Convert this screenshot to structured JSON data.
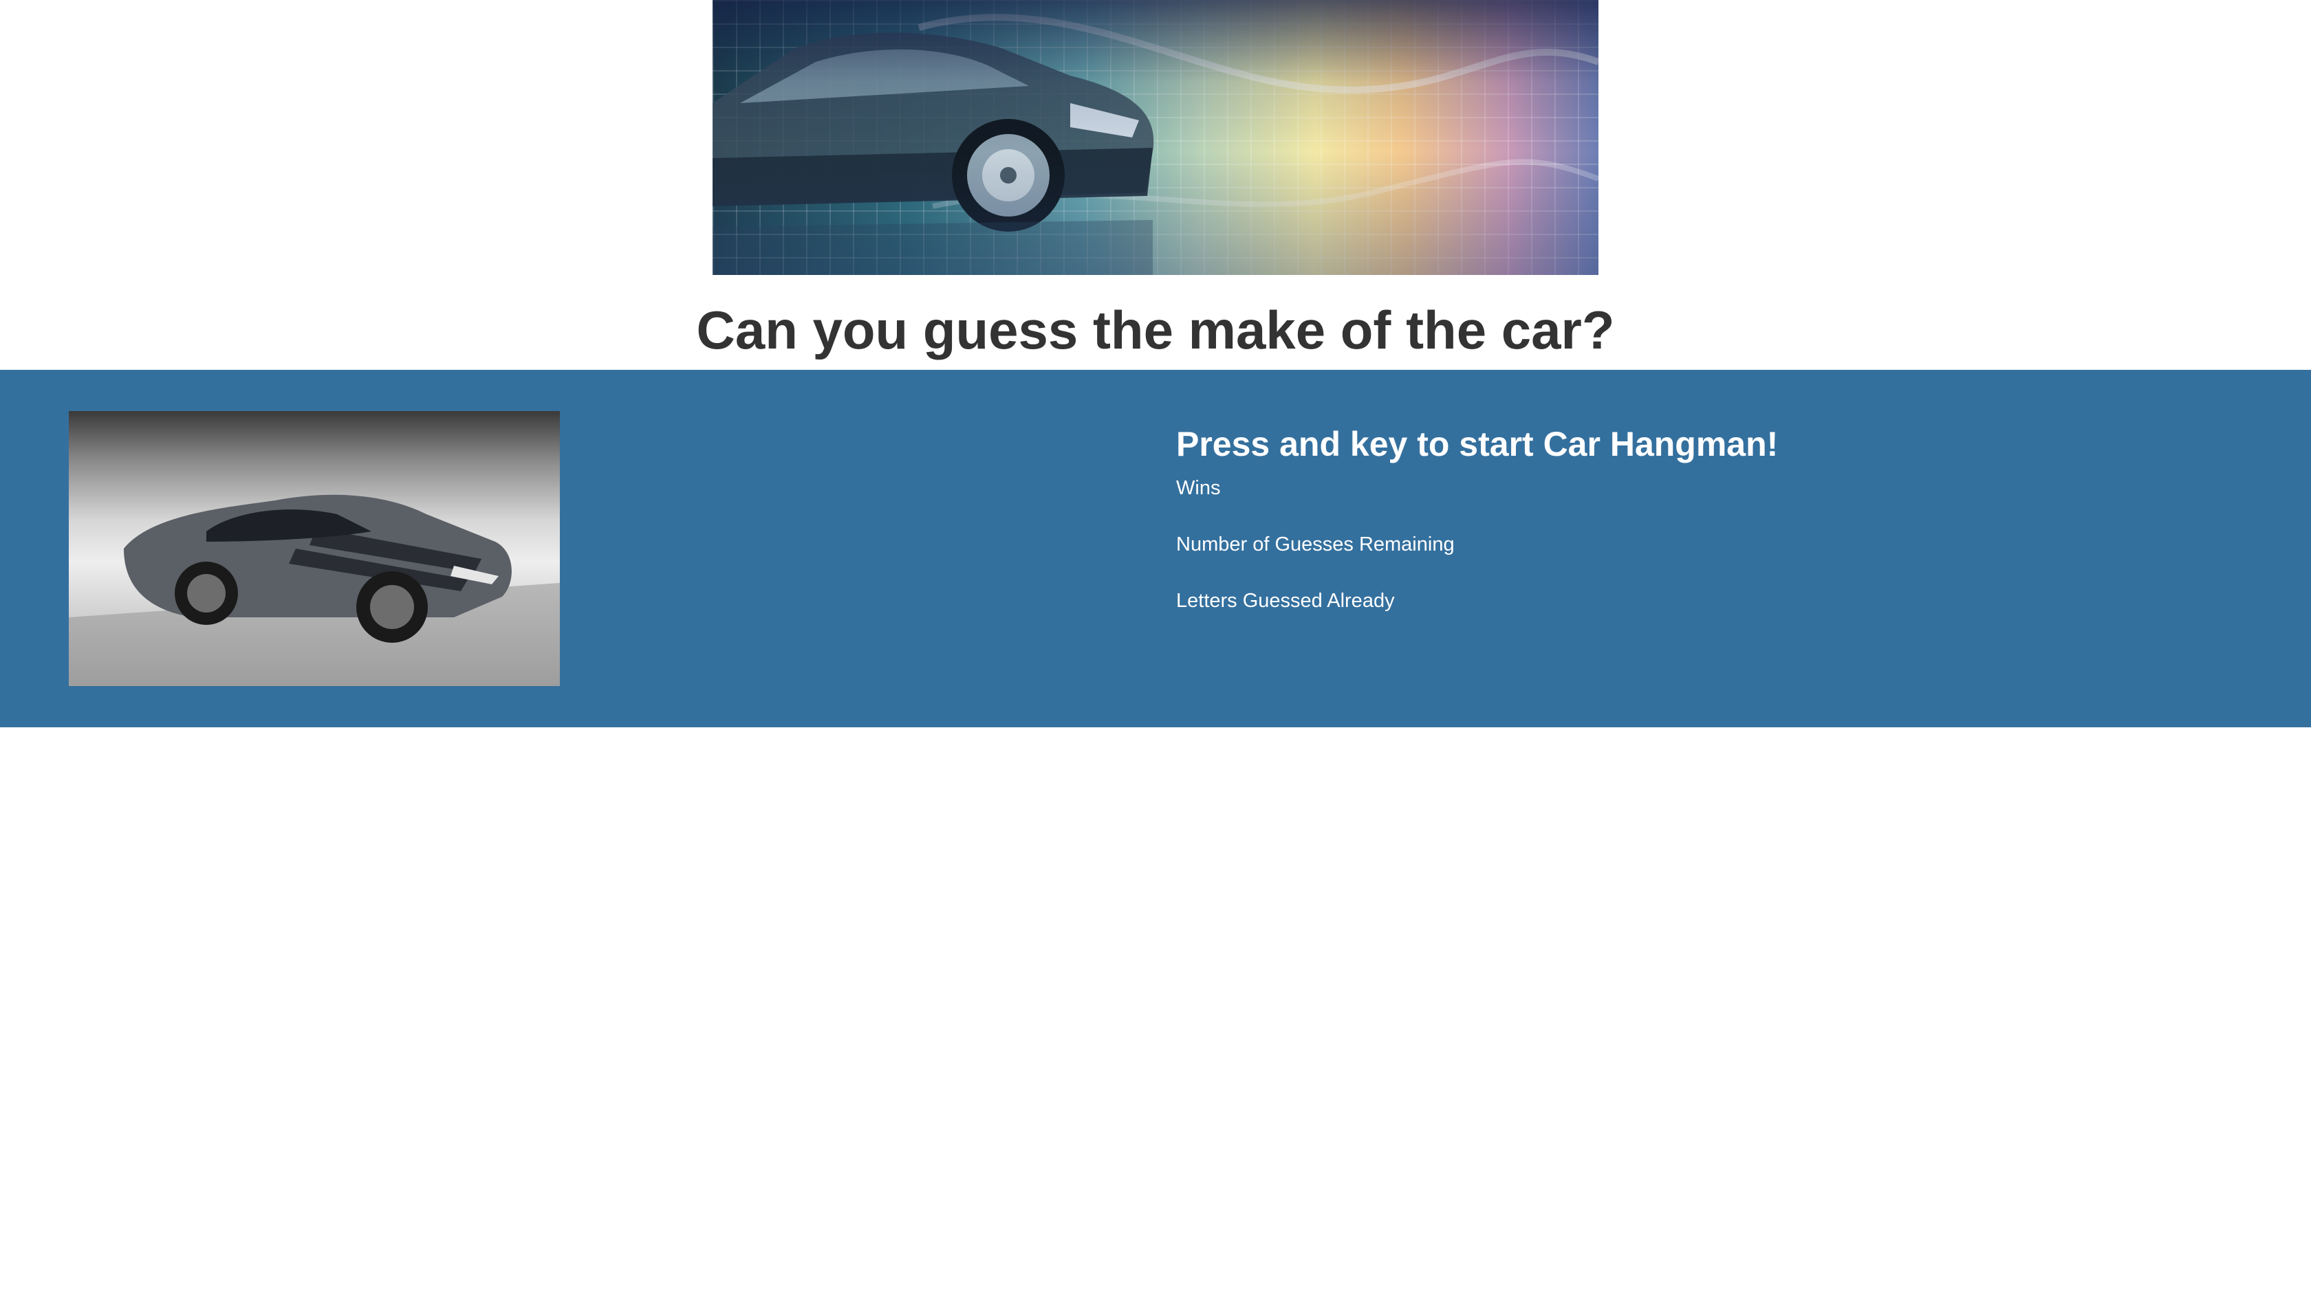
{
  "header": {
    "banner_image": "futuristic-car-banner",
    "title": "Can you guess the make of the car?"
  },
  "game": {
    "car_image": "silver-sports-car-photo",
    "prompt": "Press and key to start Car Hangman!",
    "wins_label": "Wins",
    "guesses_remaining_label": "Number of Guesses Remaining",
    "letters_guessed_label": "Letters Guessed Already"
  },
  "colors": {
    "band_background": "#34709e",
    "title_text": "#333333",
    "band_text": "#ffffff"
  }
}
